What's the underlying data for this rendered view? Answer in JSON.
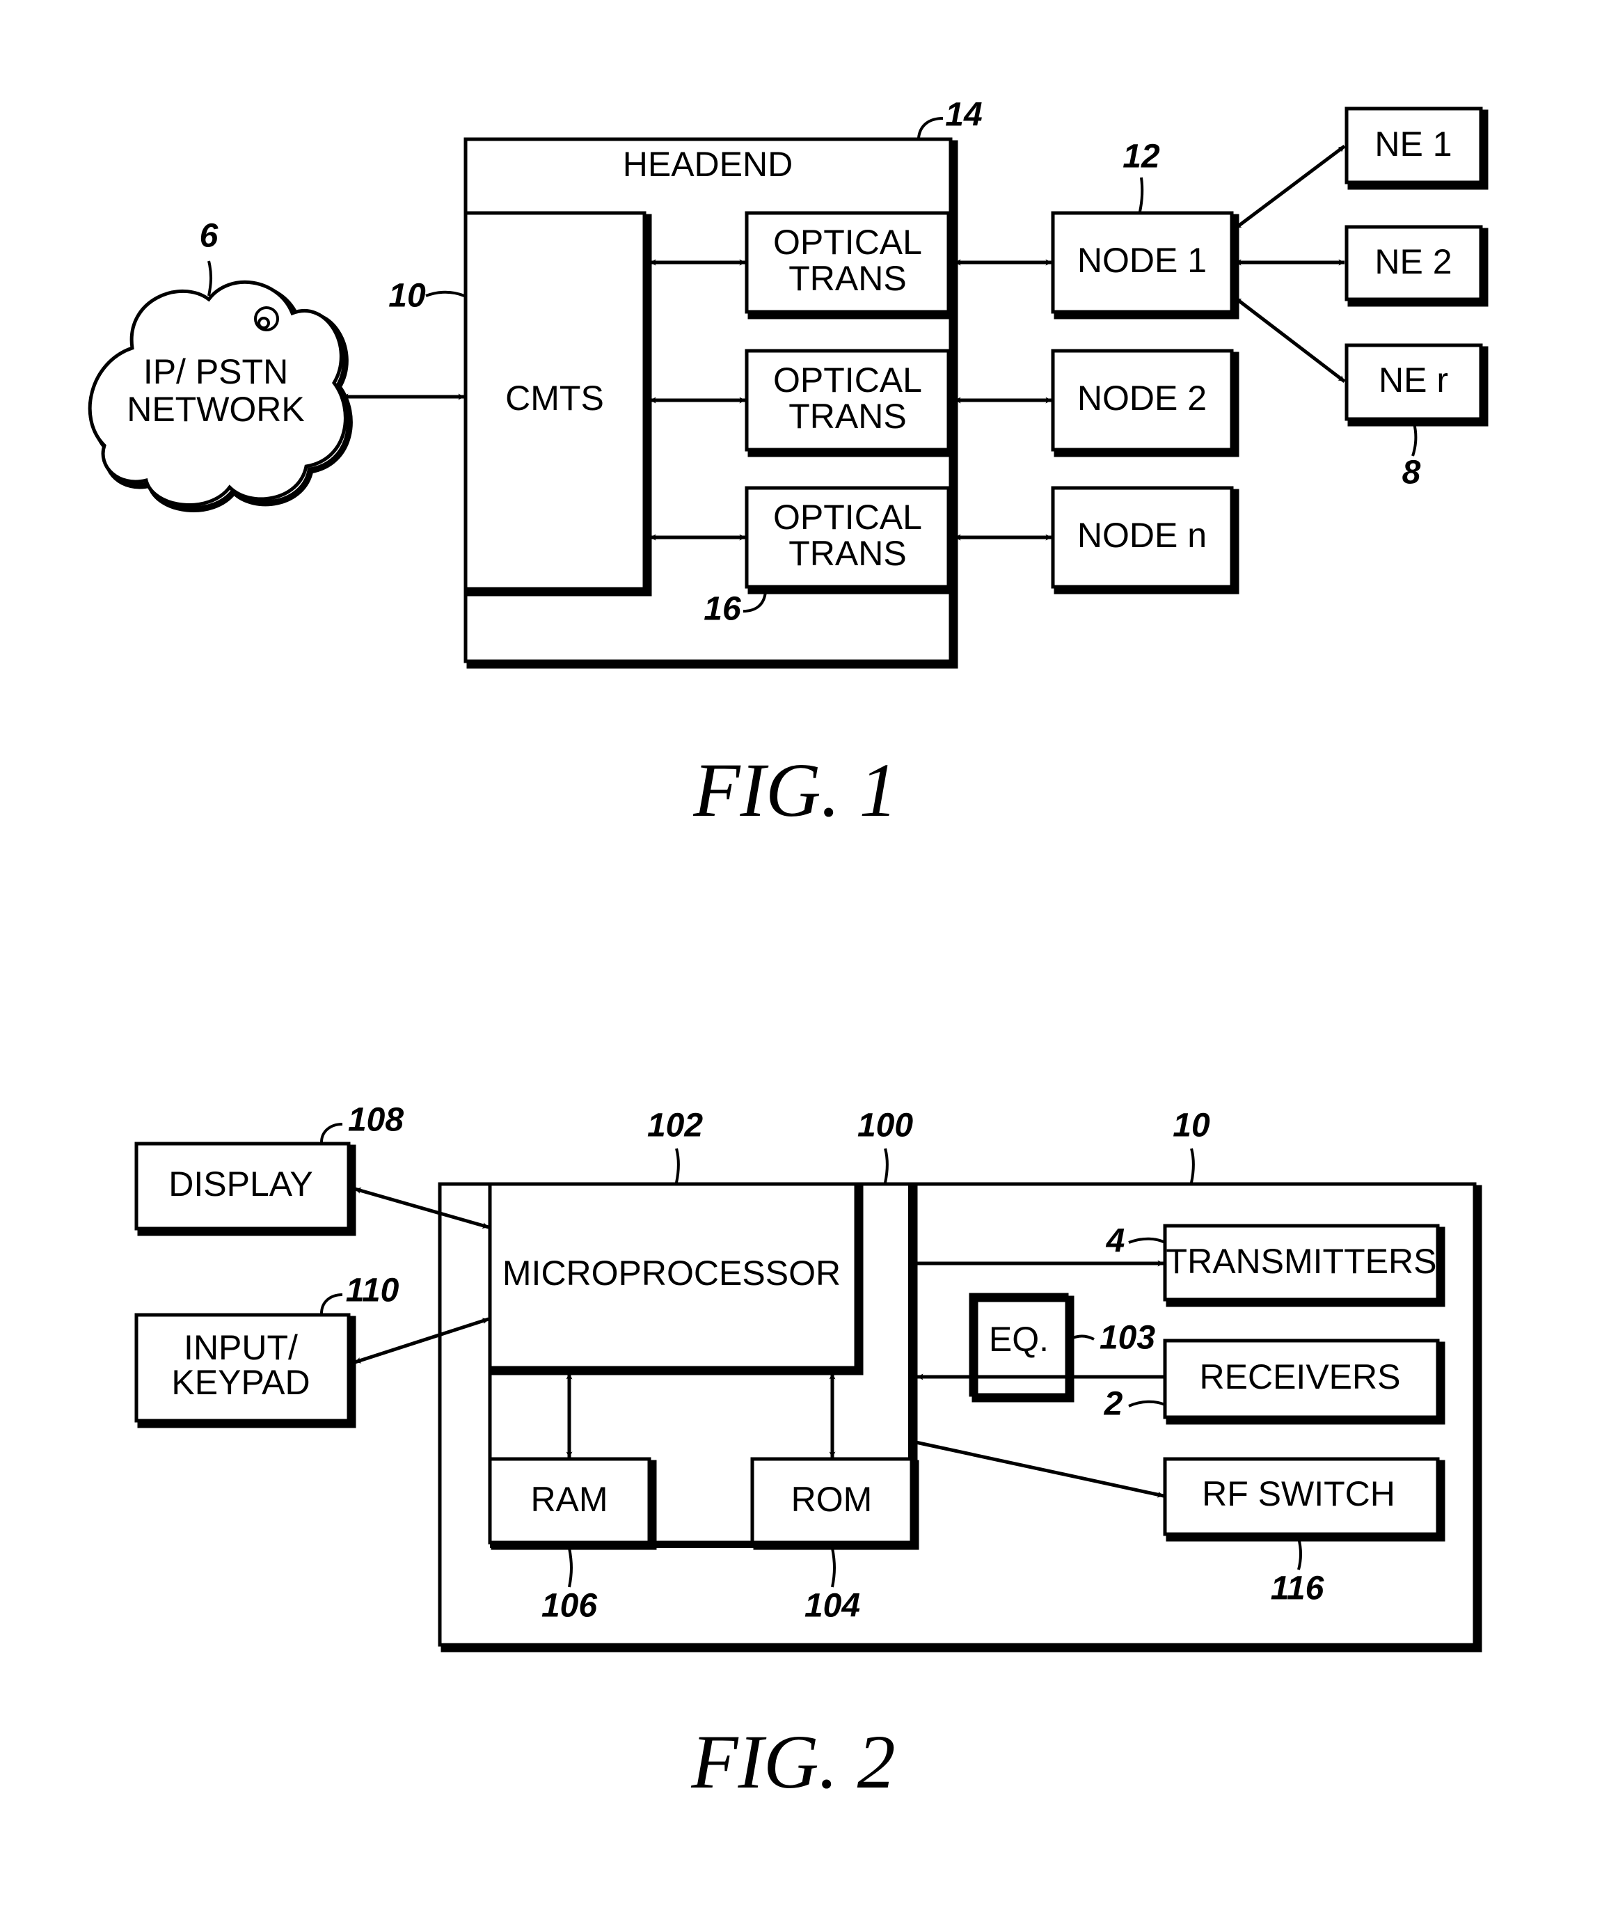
{
  "fig1": {
    "caption": "FIG. 1",
    "cloud": {
      "line1": "IP/ PSTN",
      "line2": "NETWORK",
      "ref": "6"
    },
    "headend": {
      "label": "HEADEND",
      "ref": "14"
    },
    "cmts": {
      "label": "CMTS",
      "ref": "10"
    },
    "optical_trans": [
      {
        "line1": "OPTICAL",
        "line2": "TRANS"
      },
      {
        "line1": "OPTICAL",
        "line2": "TRANS"
      },
      {
        "line1": "OPTICAL",
        "line2": "TRANS",
        "ref": "16"
      }
    ],
    "nodes": [
      {
        "label": "NODE 1",
        "ref": "12"
      },
      {
        "label": "NODE 2"
      },
      {
        "label": "NODE n"
      }
    ],
    "network_elements": [
      {
        "label": "NE 1"
      },
      {
        "label": "NE 2"
      },
      {
        "label": "NE r",
        "ref": "8"
      }
    ]
  },
  "fig2": {
    "caption": "FIG. 2",
    "outer_ref": "10",
    "inner_ref": "100",
    "display": {
      "label": "DISPLAY",
      "ref": "108"
    },
    "input": {
      "line1": "INPUT/",
      "line2": "KEYPAD",
      "ref": "110"
    },
    "microprocessor": {
      "label": "MICROPROCESSOR",
      "ref": "102"
    },
    "ram": {
      "label": "RAM",
      "ref": "106"
    },
    "rom": {
      "label": "ROM",
      "ref": "104"
    },
    "transmitters": {
      "label": "TRANSMITTERS",
      "ref": "4"
    },
    "receivers": {
      "label": "RECEIVERS",
      "ref": "2"
    },
    "eq": {
      "label": "EQ.",
      "ref": "103"
    },
    "rf_switch": {
      "label": "RF SWITCH",
      "ref": "116"
    }
  }
}
